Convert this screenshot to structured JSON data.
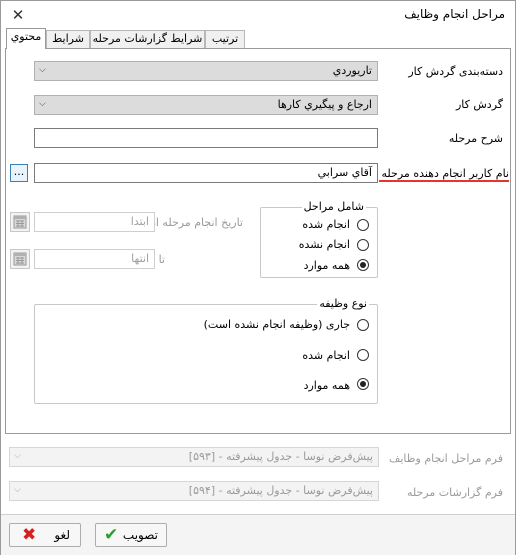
{
  "window": {
    "title": "مراحل انجام وظايف"
  },
  "tabs": [
    {
      "label": "محتوي",
      "active": true
    },
    {
      "label": "شرايط",
      "active": false
    },
    {
      "label": "شرايط گزارشات مرحله",
      "active": false
    },
    {
      "label": "ترتيب",
      "active": false
    }
  ],
  "form": {
    "workflow_category": {
      "label": "دسته‌بندی گردش کار",
      "value": "تاريوردي"
    },
    "workflow": {
      "label": "گردش کار",
      "value": "ارجاع و پيگيري کارها"
    },
    "stage_description": {
      "label": "شرح مرحله",
      "value": ""
    },
    "stage_user": {
      "label": "نام کاربر انجام دهنده مرحله",
      "value": "آقاي سرابي",
      "browse": "..."
    },
    "date_from": {
      "label": "تاريخ انجام مرحله از",
      "placeholder": "ابتدا"
    },
    "date_to": {
      "label": "تا",
      "placeholder": "انتها"
    }
  },
  "stage_group": {
    "legend": "شامل مراحل",
    "options": [
      {
        "label": "انجام شده",
        "selected": false
      },
      {
        "label": "انجام نشده",
        "selected": false
      },
      {
        "label": "همه موارد",
        "selected": true
      }
    ]
  },
  "task_type_group": {
    "legend": "نوع وظيفه",
    "options": [
      {
        "label": "جاری (وظيفه انجام نشده است)",
        "selected": false
      },
      {
        "label": "انجام شده",
        "selected": false
      },
      {
        "label": "همه موارد",
        "selected": true
      }
    ]
  },
  "forms": {
    "stage_form": {
      "label": "فرم مراحل انجام وظايف",
      "value": "پيش‌فرض نوسا - جدول پيشرفته - [۵۹۳]"
    },
    "report_form": {
      "label": "فرم گزارشات مرحله",
      "value": "پيش‌فرض نوسا - جدول پيشرفته - [۵۹۴]"
    }
  },
  "buttons": {
    "ok": "تصويب",
    "cancel": "لغو"
  },
  "icons": {
    "close": "close-icon",
    "calendar": "calendar-icon",
    "ok": "checkmark-icon",
    "cancel": "x-icon"
  },
  "colors": {
    "accent_underline": "#e8352b",
    "ok_green": "#2aa02a",
    "cancel_red": "#d42020"
  }
}
